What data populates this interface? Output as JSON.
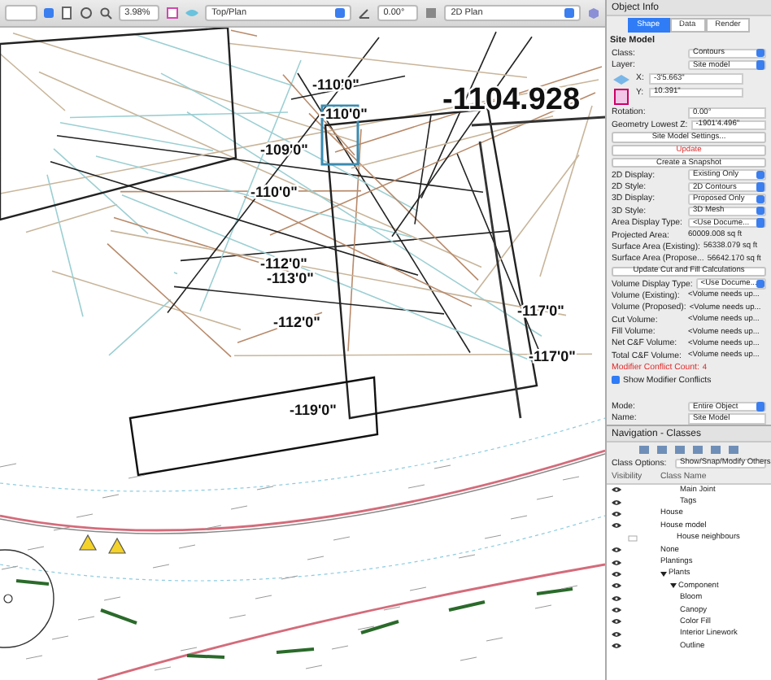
{
  "toolbar": {
    "zoom": "3.98%",
    "view": "Top/Plan",
    "rotation": "0.00°",
    "render_mode": "2D Plan"
  },
  "drawing": {
    "elevations": [
      "-110'0\"",
      "-110'0\"",
      "-1104.928",
      "-109'0\"",
      "-110'0\"",
      "-112'0\"",
      "-113'0\"",
      "-112'0\"",
      "-117'0\"",
      "-117'0\"",
      "-119'0\""
    ]
  },
  "object_info": {
    "title": "Object Info",
    "tabs": [
      {
        "label": "Shape",
        "selected": true
      },
      {
        "label": "Data",
        "selected": false
      },
      {
        "label": "Render",
        "selected": false
      }
    ],
    "object_type": "Site Model",
    "fields": [
      {
        "kind": "select",
        "label": "Class:",
        "value": "Contours"
      },
      {
        "kind": "select",
        "label": "Layer:",
        "value": "Site model"
      },
      {
        "kind": "xy",
        "label": "X:",
        "value": "-3'5.663\""
      },
      {
        "kind": "xy",
        "label": "Y:",
        "value": "10.391\""
      },
      {
        "kind": "input",
        "label": "Rotation:",
        "value": "0.00°"
      },
      {
        "kind": "input",
        "label": "Geometry Lowest Z:",
        "value": "-1901'4.496\""
      },
      {
        "kind": "button",
        "label": "Site Model Settings...",
        "warning": false
      },
      {
        "kind": "button",
        "label": "Update",
        "warning": true
      },
      {
        "kind": "button",
        "label": "Create a Snapshot",
        "warning": false
      },
      {
        "kind": "select",
        "label": "2D Display:",
        "value": "Existing Only"
      },
      {
        "kind": "select",
        "label": "2D Style:",
        "value": "2D Contours"
      },
      {
        "kind": "select",
        "label": "3D Display:",
        "value": "Proposed Only"
      },
      {
        "kind": "select",
        "label": "3D Style:",
        "value": "3D Mesh"
      },
      {
        "kind": "select",
        "label": "Area Display Type:",
        "value": "<Use Docume..."
      },
      {
        "kind": "readout",
        "label": "Projected Area:",
        "value": "60009.008  sq ft",
        "warning": false
      },
      {
        "kind": "readout",
        "label": "Surface Area (Existing):",
        "value": "56338.079  sq ft",
        "warning": false
      },
      {
        "kind": "readout",
        "label": "Surface Area (Propose...",
        "value": "56642.170  sq ft",
        "warning": false
      },
      {
        "kind": "button",
        "label": "Update Cut and Fill Calculations",
        "warning": false
      },
      {
        "kind": "select",
        "label": "Volume Display Type:",
        "value": "<Use Docume..."
      },
      {
        "kind": "readout",
        "label": "Volume (Existing):",
        "value": "<Volume needs up...",
        "warning": false
      },
      {
        "kind": "readout",
        "label": "Volume (Proposed):",
        "value": "<Volume needs up...",
        "warning": false
      },
      {
        "kind": "readout",
        "label": "Cut Volume:",
        "value": "<Volume needs up...",
        "warning": false
      },
      {
        "kind": "readout",
        "label": "Fill Volume:",
        "value": "<Volume needs up...",
        "warning": false
      },
      {
        "kind": "readout",
        "label": "Net C&F Volume:",
        "value": "<Volume needs up...",
        "warning": false
      },
      {
        "kind": "readout",
        "label": "Total C&F Volume:",
        "value": "<Volume needs up...",
        "warning": false
      },
      {
        "kind": "readout",
        "label": "Modifier Conflict Count:",
        "value": "4",
        "warning": true
      },
      {
        "kind": "checkbox",
        "label": "Show Modifier Conflicts",
        "checked": true
      },
      {
        "kind": "spacer"
      },
      {
        "kind": "select",
        "label": "Mode:",
        "value": "Entire Object"
      },
      {
        "kind": "input",
        "label": "Name:",
        "value": "Site Model"
      }
    ]
  },
  "navigation": {
    "title": "Navigation - Classes",
    "class_options_label": "Class Options:",
    "class_options": "Show/Snap/Modify Others",
    "columns": [
      "Visibility",
      "Class Name"
    ],
    "classes": [
      {
        "name": "Main Joint",
        "visible": true,
        "indent": true
      },
      {
        "name": "Tags",
        "visible": true,
        "indent": true
      },
      {
        "name": "House",
        "visible": true
      },
      {
        "name": "House model",
        "visible": true
      },
      {
        "name": "House neighbours",
        "visible": false
      },
      {
        "name": "None",
        "visible": true
      },
      {
        "name": "Plantings",
        "visible": true
      },
      {
        "name": "Plants",
        "visible": true,
        "expanded": true,
        "children": [
          {
            "name": "Component",
            "visible": true,
            "expanded": true,
            "children": [
              {
                "name": "Bloom",
                "visible": true
              },
              {
                "name": "Canopy",
                "visible": true
              },
              {
                "name": "Color Fill",
                "visible": true
              },
              {
                "name": "Interior Linework",
                "visible": true
              },
              {
                "name": "Outline",
                "visible": true
              }
            ]
          }
        ]
      }
    ]
  }
}
